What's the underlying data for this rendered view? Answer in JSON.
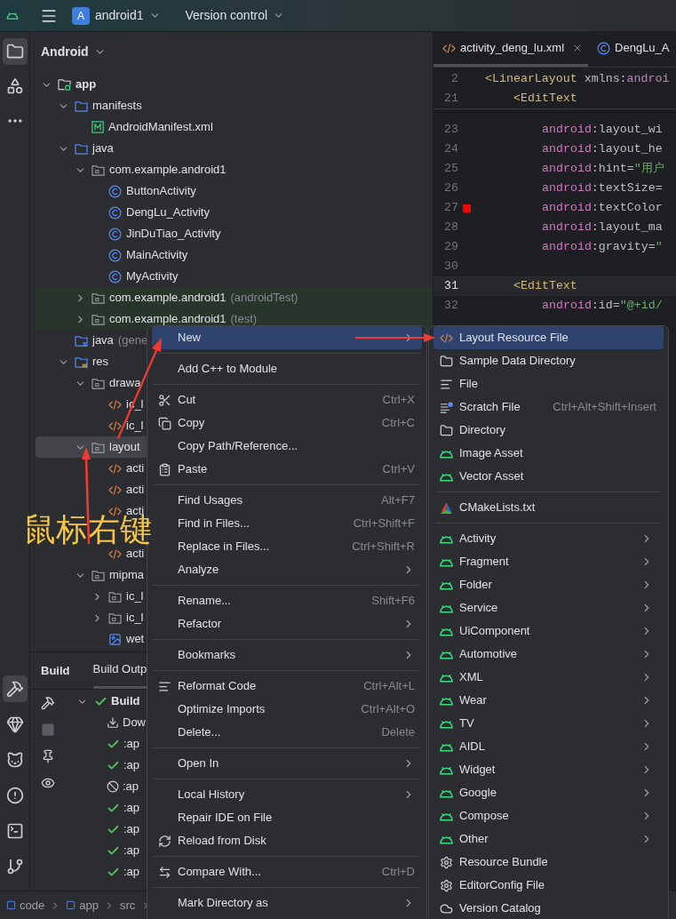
{
  "topbar": {
    "project_badge": "A",
    "project": "android1",
    "vcs": "Version control"
  },
  "tool_strip": {
    "top": [
      {
        "kind": "folder",
        "selected": true
      },
      {
        "kind": "shapes",
        "selected": false
      },
      {
        "kind": "more",
        "selected": false
      }
    ],
    "bottom": [
      {
        "kind": "hammer",
        "selected": true
      },
      {
        "kind": "gem",
        "selected": false
      },
      {
        "kind": "cat",
        "selected": false
      },
      {
        "kind": "alert",
        "selected": false
      },
      {
        "kind": "terminal",
        "selected": false
      },
      {
        "kind": "git",
        "selected": false
      }
    ]
  },
  "project_panel": {
    "title": "Android",
    "tree": [
      {
        "label": "app",
        "kind": "module",
        "expanded": true,
        "selected": false,
        "children": [
          {
            "label": "manifests",
            "kind": "folder",
            "expanded": true,
            "selected": false,
            "children": [
              {
                "label": "AndroidManifest.xml",
                "kind": "manifest",
                "selected": false
              }
            ]
          },
          {
            "label": "java",
            "kind": "folder",
            "expanded": true,
            "selected": false,
            "children": [
              {
                "label": "com.example.android1",
                "kind": "package",
                "expanded": true,
                "selected": false,
                "children": [
                  {
                    "label": "ButtonActivity",
                    "kind": "class",
                    "selected": false
                  },
                  {
                    "label": "DengLu_Activity",
                    "kind": "class",
                    "selected": false
                  },
                  {
                    "label": "JinDuTiao_Activity",
                    "kind": "class",
                    "selected": false
                  },
                  {
                    "label": "MainActivity",
                    "kind": "class",
                    "selected": false
                  },
                  {
                    "label": "MyActivity",
                    "kind": "class",
                    "selected": false
                  }
                ]
              },
              {
                "label": "com.example.android1",
                "suffix": "(androidTest)",
                "kind": "test-package",
                "expanded": false,
                "selected": false
              },
              {
                "label": "com.example.android1",
                "suffix": "(test)",
                "kind": "test-package",
                "expanded": false,
                "selected": false
              }
            ]
          },
          {
            "label": "java",
            "suffix": "(gene",
            "kind": "generated",
            "selected": false
          },
          {
            "label": "res",
            "kind": "resources",
            "expanded": true,
            "selected": false,
            "children": [
              {
                "label": "drawa",
                "kind": "package",
                "expanded": true,
                "selected": false,
                "children": [
                  {
                    "label": "ic_l",
                    "kind": "xml",
                    "selected": false
                  },
                  {
                    "label": "ic_l",
                    "kind": "xml",
                    "selected": false
                  }
                ]
              },
              {
                "label": "layout",
                "kind": "package",
                "expanded": true,
                "selected": true,
                "children": [
                  {
                    "label": "acti",
                    "kind": "xml",
                    "selected": false
                  },
                  {
                    "label": "acti",
                    "kind": "xml",
                    "selected": false
                  },
                  {
                    "label": "acti",
                    "kind": "xml",
                    "selected": false
                  },
                  {
                    "kind": "obscured",
                    "selected": false
                  },
                  {
                    "label": "acti",
                    "kind": "xml",
                    "selected": false
                  }
                ]
              },
              {
                "label": "mipma",
                "kind": "package",
                "expanded": true,
                "selected": false,
                "children": [
                  {
                    "label": "ic_l",
                    "kind": "package",
                    "expanded": false,
                    "selected": false
                  },
                  {
                    "label": "ic_l",
                    "kind": "package",
                    "expanded": false,
                    "selected": false
                  },
                  {
                    "label": "wet",
                    "kind": "image",
                    "selected": false
                  }
                ]
              }
            ]
          }
        ]
      }
    ]
  },
  "build_panel": {
    "title": "Build",
    "tabs": [
      {
        "label": "Build Outp",
        "selected": true
      }
    ],
    "side_icons": [
      {
        "kind": "hammer"
      },
      {
        "kind": "stop"
      },
      {
        "kind": "pin"
      },
      {
        "kind": "eye"
      }
    ],
    "tree": [
      {
        "label": "Build",
        "kind": "success",
        "expanded": true,
        "children": [
          {
            "label": "Dow",
            "kind": "download"
          },
          {
            "label": ":ap",
            "kind": "success"
          },
          {
            "label": ":ap",
            "kind": "success"
          },
          {
            "label": ":ap",
            "kind": "skipped"
          },
          {
            "label": ":ap",
            "kind": "success"
          },
          {
            "label": ":ap",
            "kind": "success"
          },
          {
            "label": ":ap",
            "kind": "success"
          },
          {
            "label": ":ap",
            "kind": "success"
          }
        ]
      }
    ]
  },
  "breadcrumb": [
    {
      "label": "code",
      "kind": "module"
    },
    {
      "label": "app",
      "kind": "module"
    },
    {
      "label": "src",
      "kind": "folder"
    }
  ],
  "editor": {
    "tabs": [
      {
        "label": "activity_deng_lu.xml",
        "kind": "xml",
        "selected": true
      },
      {
        "label": "DengLu_A",
        "kind": "class",
        "selected": false
      }
    ],
    "sticky_lines": [
      {
        "number": "2",
        "kind": "root",
        "segments": [
          {
            "text": "<LinearLayout",
            "kind": "tag"
          },
          {
            "text": " xmlns:",
            "kind": "plain"
          },
          {
            "text": "androi",
            "kind": "ns"
          }
        ]
      },
      {
        "number": "21",
        "kind": "element",
        "segments": [
          {
            "text": "<EditText",
            "kind": "tag"
          }
        ]
      }
    ],
    "lines": [
      {
        "number": "23",
        "kind": "attribute",
        "current": false,
        "segments": [
          {
            "text": "android",
            "kind": "ns"
          },
          {
            "text": ":layout_wi",
            "kind": "plain"
          }
        ]
      },
      {
        "number": "24",
        "kind": "attribute",
        "current": false,
        "segments": [
          {
            "text": "android",
            "kind": "ns"
          },
          {
            "text": ":layout_he",
            "kind": "plain"
          }
        ]
      },
      {
        "number": "25",
        "kind": "attribute",
        "current": false,
        "segments": [
          {
            "text": "android",
            "kind": "ns"
          },
          {
            "text": ":hint=",
            "kind": "plain"
          },
          {
            "text": "\"用户",
            "kind": "str"
          }
        ]
      },
      {
        "number": "26",
        "kind": "attribute",
        "current": false,
        "segments": [
          {
            "text": "android",
            "kind": "ns"
          },
          {
            "text": ":textSize=",
            "kind": "plain"
          }
        ]
      },
      {
        "number": "27",
        "kind": "attribute",
        "current": false,
        "color": "#ff0000",
        "segments": [
          {
            "text": "android",
            "kind": "ns"
          },
          {
            "text": ":textColor",
            "kind": "plain"
          }
        ]
      },
      {
        "number": "28",
        "kind": "attribute",
        "current": false,
        "segments": [
          {
            "text": "android",
            "kind": "ns"
          },
          {
            "text": ":layout_ma",
            "kind": "plain"
          }
        ]
      },
      {
        "number": "29",
        "kind": "attribute",
        "current": false,
        "segments": [
          {
            "text": "android",
            "kind": "ns"
          },
          {
            "text": ":gravity=",
            "kind": "plain"
          },
          {
            "text": "\"",
            "kind": "str"
          }
        ]
      },
      {
        "number": "30",
        "current": false
      },
      {
        "number": "31",
        "kind": "element",
        "current": true,
        "segments": [
          {
            "text": "<EditText",
            "kind": "tag"
          }
        ]
      },
      {
        "number": "32",
        "kind": "attribute",
        "current": false,
        "segments": [
          {
            "text": "android",
            "kind": "ns"
          },
          {
            "text": ":id=",
            "kind": "plain"
          },
          {
            "text": "\"@+id/",
            "kind": "str"
          }
        ]
      }
    ]
  },
  "context_menu": {
    "items": [
      {
        "kind": "plain",
        "label": "New",
        "submenu": true,
        "selected": true
      },
      {
        "kind": "separator"
      },
      {
        "kind": "plain",
        "label": "Add C++ to Module",
        "submenu": false,
        "selected": false
      },
      {
        "kind": "separator"
      },
      {
        "kind": "cut",
        "label": "Cut",
        "shortcut": "Ctrl+X",
        "submenu": false,
        "selected": false
      },
      {
        "kind": "copy",
        "label": "Copy",
        "shortcut": "Ctrl+C",
        "submenu": false,
        "selected": false
      },
      {
        "kind": "plain",
        "label": "Copy Path/Reference...",
        "submenu": false,
        "selected": false
      },
      {
        "kind": "paste",
        "label": "Paste",
        "shortcut": "Ctrl+V",
        "submenu": false,
        "selected": false
      },
      {
        "kind": "separator"
      },
      {
        "kind": "plain",
        "label": "Find Usages",
        "shortcut": "Alt+F7",
        "submenu": false,
        "selected": false
      },
      {
        "kind": "plain",
        "label": "Find in Files...",
        "shortcut": "Ctrl+Shift+F",
        "submenu": false,
        "selected": false
      },
      {
        "kind": "plain",
        "label": "Replace in Files...",
        "shortcut": "Ctrl+Shift+R",
        "submenu": false,
        "selected": false
      },
      {
        "kind": "plain",
        "label": "Analyze",
        "submenu": true,
        "selected": false
      },
      {
        "kind": "separator"
      },
      {
        "kind": "plain",
        "label": "Rename...",
        "shortcut": "Shift+F6",
        "submenu": false,
        "selected": false
      },
      {
        "kind": "plain",
        "label": "Refactor",
        "submenu": true,
        "selected": false
      },
      {
        "kind": "separator"
      },
      {
        "kind": "plain",
        "label": "Bookmarks",
        "submenu": true,
        "selected": false
      },
      {
        "kind": "separator"
      },
      {
        "kind": "reformat",
        "label": "Reformat Code",
        "shortcut": "Ctrl+Alt+L",
        "submenu": false,
        "selected": false
      },
      {
        "kind": "plain",
        "label": "Optimize Imports",
        "shortcut": "Ctrl+Alt+O",
        "submenu": false,
        "selected": false
      },
      {
        "kind": "plain",
        "label": "Delete...",
        "shortcut": "Delete",
        "submenu": false,
        "selected": false
      },
      {
        "kind": "separator"
      },
      {
        "kind": "plain",
        "label": "Open In",
        "submenu": true,
        "selected": false
      },
      {
        "kind": "separator"
      },
      {
        "kind": "plain",
        "label": "Local History",
        "submenu": true,
        "selected": false
      },
      {
        "kind": "plain",
        "label": "Repair IDE on File",
        "submenu": false,
        "selected": false
      },
      {
        "kind": "reload",
        "label": "Reload from Disk",
        "submenu": false,
        "selected": false
      },
      {
        "kind": "separator"
      },
      {
        "kind": "compare",
        "label": "Compare With...",
        "shortcut": "Ctrl+D",
        "submenu": false,
        "selected": false
      },
      {
        "kind": "separator"
      },
      {
        "kind": "plain",
        "label": "Mark Directory as",
        "submenu": true,
        "selected": false
      }
    ]
  },
  "new_submenu": {
    "items": [
      {
        "kind": "xml",
        "label": "Layout Resource File",
        "submenu": false,
        "selected": true
      },
      {
        "kind": "folder",
        "label": "Sample Data Directory",
        "submenu": false,
        "selected": false
      },
      {
        "kind": "file",
        "label": "File",
        "submenu": false,
        "selected": false
      },
      {
        "kind": "scratch",
        "label": "Scratch File",
        "shortcut": "Ctrl+Alt+Shift+Insert",
        "submenu": false,
        "selected": false
      },
      {
        "kind": "folder",
        "label": "Directory",
        "submenu": false,
        "selected": false
      },
      {
        "kind": "android",
        "label": "Image Asset",
        "submenu": false,
        "selected": false
      },
      {
        "kind": "android",
        "label": "Vector Asset",
        "submenu": false,
        "selected": false
      },
      {
        "kind": "separator"
      },
      {
        "kind": "cmake",
        "label": "CMakeLists.txt",
        "submenu": false,
        "selected": false
      },
      {
        "kind": "separator"
      },
      {
        "kind": "android",
        "label": "Activity",
        "submenu": true,
        "selected": false
      },
      {
        "kind": "android",
        "label": "Fragment",
        "submenu": true,
        "selected": false
      },
      {
        "kind": "android",
        "label": "Folder",
        "submenu": true,
        "selected": false
      },
      {
        "kind": "android",
        "label": "Service",
        "submenu": true,
        "selected": false
      },
      {
        "kind": "android",
        "label": "UiComponent",
        "submenu": true,
        "selected": false
      },
      {
        "kind": "android",
        "label": "Automotive",
        "submenu": true,
        "selected": false
      },
      {
        "kind": "android",
        "label": "XML",
        "submenu": true,
        "selected": false
      },
      {
        "kind": "android",
        "label": "Wear",
        "submenu": true,
        "selected": false
      },
      {
        "kind": "android",
        "label": "TV",
        "submenu": true,
        "selected": false
      },
      {
        "kind": "android",
        "label": "AIDL",
        "submenu": true,
        "selected": false
      },
      {
        "kind": "android",
        "label": "Widget",
        "submenu": true,
        "selected": false
      },
      {
        "kind": "android",
        "label": "Google",
        "submenu": true,
        "selected": false
      },
      {
        "kind": "android",
        "label": "Compose",
        "submenu": true,
        "selected": false
      },
      {
        "kind": "android",
        "label": "Other",
        "submenu": true,
        "selected": false
      },
      {
        "kind": "gear",
        "label": "Resource Bundle",
        "submenu": false,
        "selected": false
      },
      {
        "kind": "gear",
        "label": "EditorConfig File",
        "submenu": false,
        "selected": false
      },
      {
        "kind": "catalog",
        "label": "Version Catalog",
        "submenu": false,
        "selected": false
      }
    ]
  },
  "annotation": {
    "text": "鼠标右键"
  }
}
